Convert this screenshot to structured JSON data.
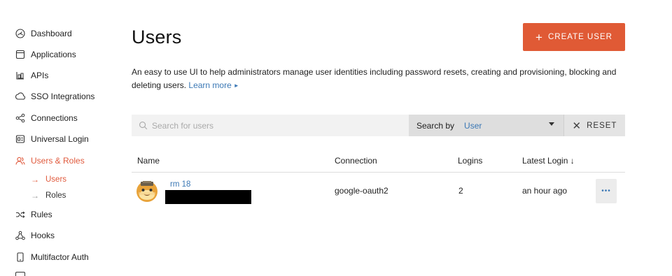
{
  "sidebar": {
    "items": [
      {
        "label": "Dashboard",
        "icon": "dashboard-icon"
      },
      {
        "label": "Applications",
        "icon": "applications-icon"
      },
      {
        "label": "APIs",
        "icon": "apis-icon"
      },
      {
        "label": "SSO Integrations",
        "icon": "sso-icon"
      },
      {
        "label": "Connections",
        "icon": "connections-icon"
      },
      {
        "label": "Universal Login",
        "icon": "universal-login-icon"
      },
      {
        "label": "Users & Roles",
        "icon": "users-icon",
        "active": true
      },
      {
        "label": "Rules",
        "icon": "rules-icon"
      },
      {
        "label": "Hooks",
        "icon": "hooks-icon"
      },
      {
        "label": "Multifactor Auth",
        "icon": "mfa-icon"
      }
    ],
    "sub_items": [
      {
        "label": "Users",
        "active": true
      },
      {
        "label": "Roles",
        "active": false
      }
    ],
    "sub_arrow": "→"
  },
  "page": {
    "title": "Users",
    "create_button": "CREATE USER",
    "create_plus": "+",
    "description": "An easy to use UI to help administrators manage user identities including password resets, creating and provisioning, blocking and deleting users.",
    "learn_more": "Learn more",
    "learn_more_arrow": "►"
  },
  "search": {
    "placeholder": "Search for users",
    "search_by_label": "Search by",
    "search_by_value": "User",
    "reset_label": "RESET",
    "reset_x": "✕"
  },
  "table": {
    "headers": {
      "name": "Name",
      "connection": "Connection",
      "logins": "Logins",
      "latest_login": "Latest Login ↓"
    },
    "rows": [
      {
        "name": "rm 18",
        "connection": "google-oauth2",
        "logins": "2",
        "latest_login": "an hour ago",
        "more": "•••"
      }
    ]
  },
  "colors": {
    "accent": "#e05a35",
    "link": "#3b78b5"
  }
}
